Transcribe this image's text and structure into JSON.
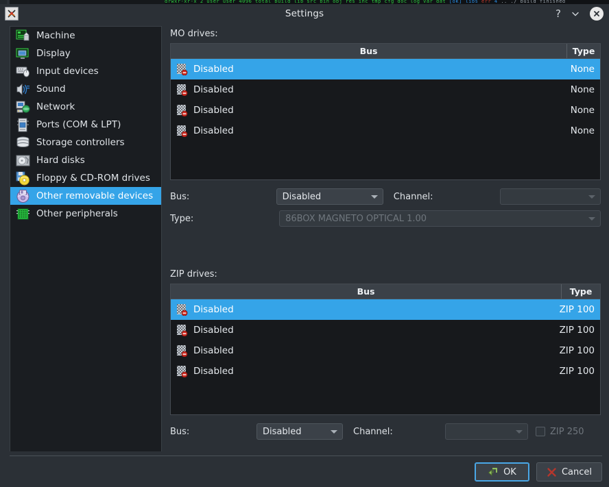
{
  "window": {
    "title": "Settings",
    "icon": "app-86box-icon",
    "controls": {
      "help": "?",
      "menu": "chevron-down-icon",
      "close": "close-icon"
    }
  },
  "sidebar": {
    "items": [
      {
        "label": "Machine",
        "icon": "machine-icon",
        "selected": false
      },
      {
        "label": "Display",
        "icon": "display-icon",
        "selected": false
      },
      {
        "label": "Input devices",
        "icon": "input-devices-icon",
        "selected": false
      },
      {
        "label": "Sound",
        "icon": "sound-icon",
        "selected": false
      },
      {
        "label": "Network",
        "icon": "network-icon",
        "selected": false
      },
      {
        "label": "Ports (COM & LPT)",
        "icon": "ports-icon",
        "selected": false
      },
      {
        "label": "Storage controllers",
        "icon": "storage-controllers-icon",
        "selected": false
      },
      {
        "label": "Hard disks",
        "icon": "hard-disks-icon",
        "selected": false
      },
      {
        "label": "Floppy & CD-ROM drives",
        "icon": "floppy-cdrom-icon",
        "selected": false
      },
      {
        "label": "Other removable devices",
        "icon": "other-removable-icon",
        "selected": true
      },
      {
        "label": "Other peripherals",
        "icon": "other-peripherals-icon",
        "selected": false
      }
    ]
  },
  "mo_section": {
    "title": "MO drives:",
    "columns": [
      "Bus",
      "Type"
    ],
    "rows": [
      {
        "bus": "Disabled",
        "type": "None",
        "selected": true
      },
      {
        "bus": "Disabled",
        "type": "None",
        "selected": false
      },
      {
        "bus": "Disabled",
        "type": "None",
        "selected": false
      },
      {
        "bus": "Disabled",
        "type": "None",
        "selected": false
      }
    ],
    "bus_label": "Bus:",
    "bus_value": "Disabled",
    "channel_label": "Channel:",
    "channel_value": "",
    "type_label": "Type:",
    "type_value": "86BOX MAGNETO OPTICAL 1.00"
  },
  "zip_section": {
    "title": "ZIP drives:",
    "columns": [
      "Bus",
      "Type"
    ],
    "rows": [
      {
        "bus": "Disabled",
        "type": "ZIP 100",
        "selected": true
      },
      {
        "bus": "Disabled",
        "type": "ZIP 100",
        "selected": false
      },
      {
        "bus": "Disabled",
        "type": "ZIP 100",
        "selected": false
      },
      {
        "bus": "Disabled",
        "type": "ZIP 100",
        "selected": false
      }
    ],
    "bus_label": "Bus:",
    "bus_value": "Disabled",
    "channel_label": "Channel:",
    "channel_value": "",
    "zip250_label": "ZIP 250",
    "zip250_checked": false
  },
  "footer": {
    "ok_label": "OK",
    "cancel_label": "Cancel"
  },
  "colors": {
    "accent_selection": "#35a4e8",
    "window_bg": "#2b3036",
    "list_bg": "#1a1d21",
    "header_bg": "#3b4148",
    "text": "#dfe3e7",
    "disabled_text": "#6f767d",
    "ok_icon": "#8fbf5f",
    "cancel_icon": "#c0392b"
  }
}
